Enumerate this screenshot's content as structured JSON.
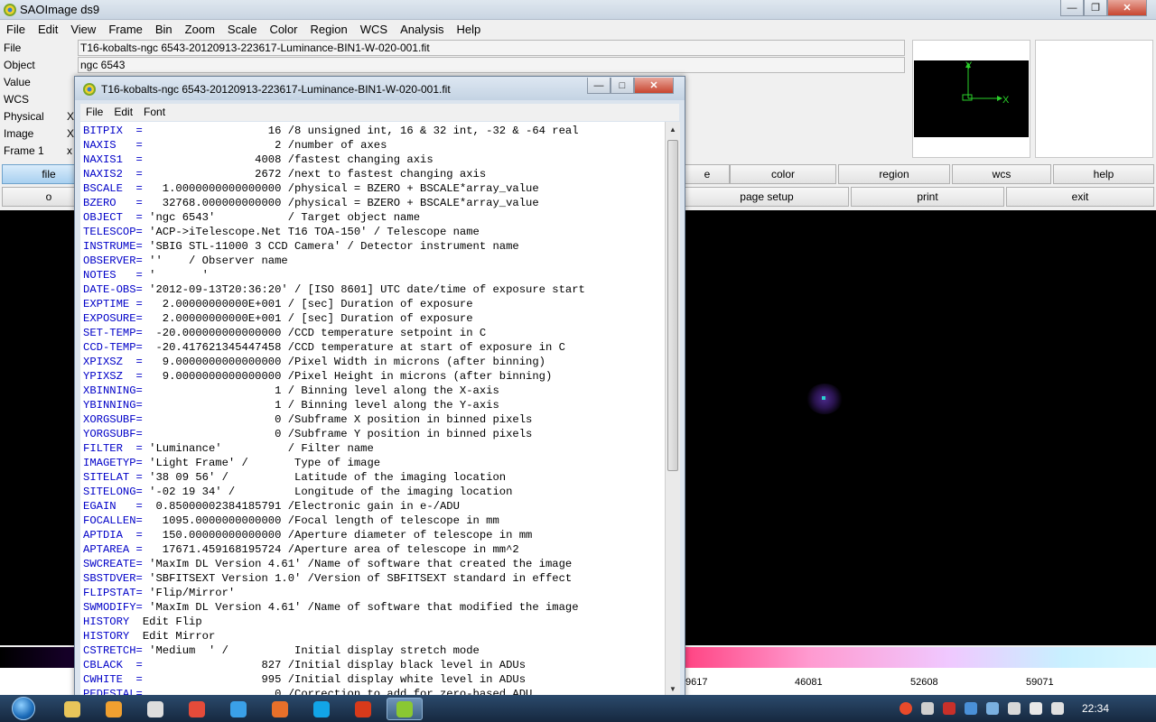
{
  "main_window": {
    "title": "SAOImage ds9",
    "menu": [
      "File",
      "Edit",
      "View",
      "Frame",
      "Bin",
      "Zoom",
      "Scale",
      "Color",
      "Region",
      "WCS",
      "Analysis",
      "Help"
    ],
    "info": {
      "file_label": "File",
      "file_value": "T16-kobalts-ngc 6543-20120913-223617-Luminance-BIN1-W-020-001.fit",
      "object_label": "Object",
      "object_value": "ngc 6543",
      "value_label": "Value",
      "wcs_label": "WCS",
      "physical_label": "Physical",
      "physical_x": "X",
      "image_label": "Image",
      "image_x": "X",
      "frame_label": "Frame 1",
      "frame_x": "x"
    },
    "panner": {
      "axis_y": "Y",
      "axis_x": "X"
    },
    "button_row1": [
      "file",
      "e",
      "color",
      "region",
      "wcs",
      "help"
    ],
    "button_row2": [
      "o",
      "page setup",
      "print",
      "exit"
    ],
    "colorbar_labels": [
      "9617",
      "46081",
      "52608",
      "59071"
    ]
  },
  "header_window": {
    "title": "T16-kobalts-ngc 6543-20120913-223617-Luminance-BIN1-W-020-001.fit",
    "menu": [
      "File",
      "Edit",
      "Font"
    ],
    "cards": [
      {
        "k": "BITPIX  =",
        "v": "                   16 /8 unsigned int, 16 & 32 int, -32 & -64 real"
      },
      {
        "k": "NAXIS   =",
        "v": "                    2 /number of axes"
      },
      {
        "k": "NAXIS1  =",
        "v": "                 4008 /fastest changing axis"
      },
      {
        "k": "NAXIS2  =",
        "v": "                 2672 /next to fastest changing axis"
      },
      {
        "k": "BSCALE  =",
        "v": "   1.0000000000000000 /physical = BZERO + BSCALE*array_value"
      },
      {
        "k": "BZERO   =",
        "v": "   32768.000000000000 /physical = BZERO + BSCALE*array_value"
      },
      {
        "k": "OBJECT  =",
        "v": " 'ngc 6543'           / Target object name"
      },
      {
        "k": "TELESCOP=",
        "v": " 'ACP->iTelescope.Net T16 TOA-150' / Telescope name"
      },
      {
        "k": "INSTRUME=",
        "v": " 'SBIG STL-11000 3 CCD Camera' / Detector instrument name"
      },
      {
        "k": "OBSERVER=",
        "v": " ''    / Observer name"
      },
      {
        "k": "NOTES   =",
        "v": " '       '"
      },
      {
        "k": "DATE-OBS=",
        "v": " '2012-09-13T20:36:20' / [ISO 8601] UTC date/time of exposure start"
      },
      {
        "k": "EXPTIME =",
        "v": "   2.00000000000E+001 / [sec] Duration of exposure"
      },
      {
        "k": "EXPOSURE=",
        "v": "   2.00000000000E+001 / [sec] Duration of exposure"
      },
      {
        "k": "SET-TEMP=",
        "v": "  -20.000000000000000 /CCD temperature setpoint in C"
      },
      {
        "k": "CCD-TEMP=",
        "v": "  -20.417621345447458 /CCD temperature at start of exposure in C"
      },
      {
        "k": "XPIXSZ  =",
        "v": "   9.0000000000000000 /Pixel Width in microns (after binning)"
      },
      {
        "k": "YPIXSZ  =",
        "v": "   9.0000000000000000 /Pixel Height in microns (after binning)"
      },
      {
        "k": "XBINNING=",
        "v": "                    1 / Binning level along the X-axis"
      },
      {
        "k": "YBINNING=",
        "v": "                    1 / Binning level along the Y-axis"
      },
      {
        "k": "XORGSUBF=",
        "v": "                    0 /Subframe X position in binned pixels"
      },
      {
        "k": "YORGSUBF=",
        "v": "                    0 /Subframe Y position in binned pixels"
      },
      {
        "k": "FILTER  =",
        "v": " 'Luminance'          / Filter name"
      },
      {
        "k": "IMAGETYP=",
        "v": " 'Light Frame' /       Type of image"
      },
      {
        "k": "SITELAT =",
        "v": " '38 09 56' /          Latitude of the imaging location"
      },
      {
        "k": "SITELONG=",
        "v": " '-02 19 34' /         Longitude of the imaging location"
      },
      {
        "k": "EGAIN   =",
        "v": "  0.85000002384185791 /Electronic gain in e-/ADU"
      },
      {
        "k": "FOCALLEN=",
        "v": "   1095.0000000000000 /Focal length of telescope in mm"
      },
      {
        "k": "APTDIA  =",
        "v": "   150.00000000000000 /Aperture diameter of telescope in mm"
      },
      {
        "k": "APTAREA =",
        "v": "   17671.459168195724 /Aperture area of telescope in mm^2"
      },
      {
        "k": "SWCREATE=",
        "v": " 'MaxIm DL Version 4.61' /Name of software that created the image"
      },
      {
        "k": "SBSTDVER=",
        "v": " 'SBFITSEXT Version 1.0' /Version of SBFITSEXT standard in effect"
      },
      {
        "k": "FLIPSTAT=",
        "v": " 'Flip/Mirror'"
      },
      {
        "k": "SWMODIFY=",
        "v": " 'MaxIm DL Version 4.61' /Name of software that modified the image"
      },
      {
        "k": "HISTORY ",
        "v": " Edit Flip"
      },
      {
        "k": "HISTORY ",
        "v": " Edit Mirror"
      },
      {
        "k": "CSTRETCH=",
        "v": " 'Medium  ' /          Initial display stretch mode"
      },
      {
        "k": "CBLACK  =",
        "v": "                  827 /Initial display black level in ADUs"
      },
      {
        "k": "CWHITE  =",
        "v": "                  995 /Initial display white level in ADUs"
      },
      {
        "k": "PEDESTAL=",
        "v": "                    0 /Correction to add for zero-based ADU"
      }
    ]
  },
  "taskbar": {
    "clock": "22:34",
    "apps": [
      {
        "name": "explorer",
        "color": "#e8c55a"
      },
      {
        "name": "media",
        "color": "#f0a030"
      },
      {
        "name": "panda",
        "color": "#dddddd"
      },
      {
        "name": "chrome",
        "color": "#e44b3a"
      },
      {
        "name": "ie",
        "color": "#3aa0e8"
      },
      {
        "name": "firefox",
        "color": "#e8702a"
      },
      {
        "name": "skype",
        "color": "#12a5e8"
      },
      {
        "name": "app-red",
        "color": "#d83a1a"
      },
      {
        "name": "ds9",
        "color": "#8ac832"
      }
    ]
  }
}
